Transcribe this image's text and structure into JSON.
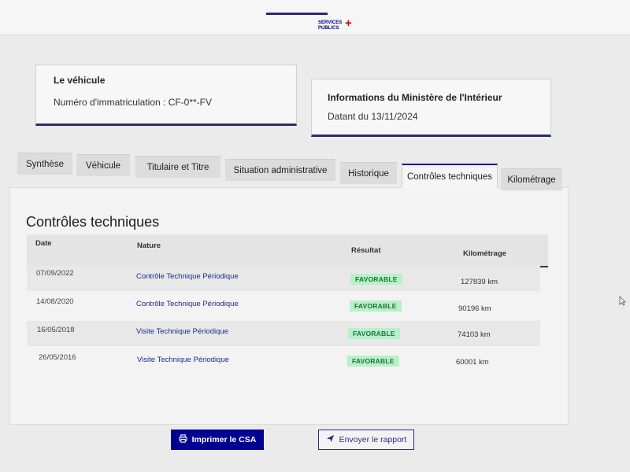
{
  "header": {
    "logo_text": "SERVICES PUBLICS",
    "logo_mark": "+"
  },
  "vehicle_card": {
    "title": "Le véhicule",
    "registration": "Numéro d'immatriculation : CF-0**-FV"
  },
  "ministry_card": {
    "title": "Informations du Ministère de l'Intérieur",
    "date": "Datant du 13/11/2024"
  },
  "tabs": [
    {
      "label": "Synthèse"
    },
    {
      "label": "Véhicule"
    },
    {
      "label": "Titulaire et Titre"
    },
    {
      "label": "Situation administrative"
    },
    {
      "label": "Historique"
    },
    {
      "label": "Contrôles techniques"
    },
    {
      "label": "Kilométrage"
    }
  ],
  "active_tab": "Contrôles techniques",
  "section": {
    "title": "Contrôles techniques",
    "columns": [
      "Date",
      "Nature",
      "Résultat",
      "Kilométrage"
    ],
    "rows": [
      {
        "date": "07/09/2022",
        "nature": "Contrôle Technique Périodique",
        "result": "FAVORABLE",
        "km": "127839 km"
      },
      {
        "date": "14/08/2020",
        "nature": "Contrôle Technique Périodique",
        "result": "FAVORABLE",
        "km": "90196 km"
      },
      {
        "date": "16/05/2018",
        "nature": "Visite Technique Périodique",
        "result": "FAVORABLE",
        "km": "74103 km"
      },
      {
        "date": "26/05/2016",
        "nature": "Visite Technique Périodique",
        "result": "FAVORABLE",
        "km": "60001 km"
      }
    ]
  },
  "actions": {
    "print_label": "Imprimer le CSA",
    "send_label": "Envoyer le rapport"
  },
  "colors": {
    "primary": "#000091",
    "success_bg": "#b8f0c8",
    "success_text": "#18753c",
    "accent_red": "#e1000f"
  },
  "icons": {
    "print": "printer-icon",
    "send": "paper-plane-icon"
  }
}
